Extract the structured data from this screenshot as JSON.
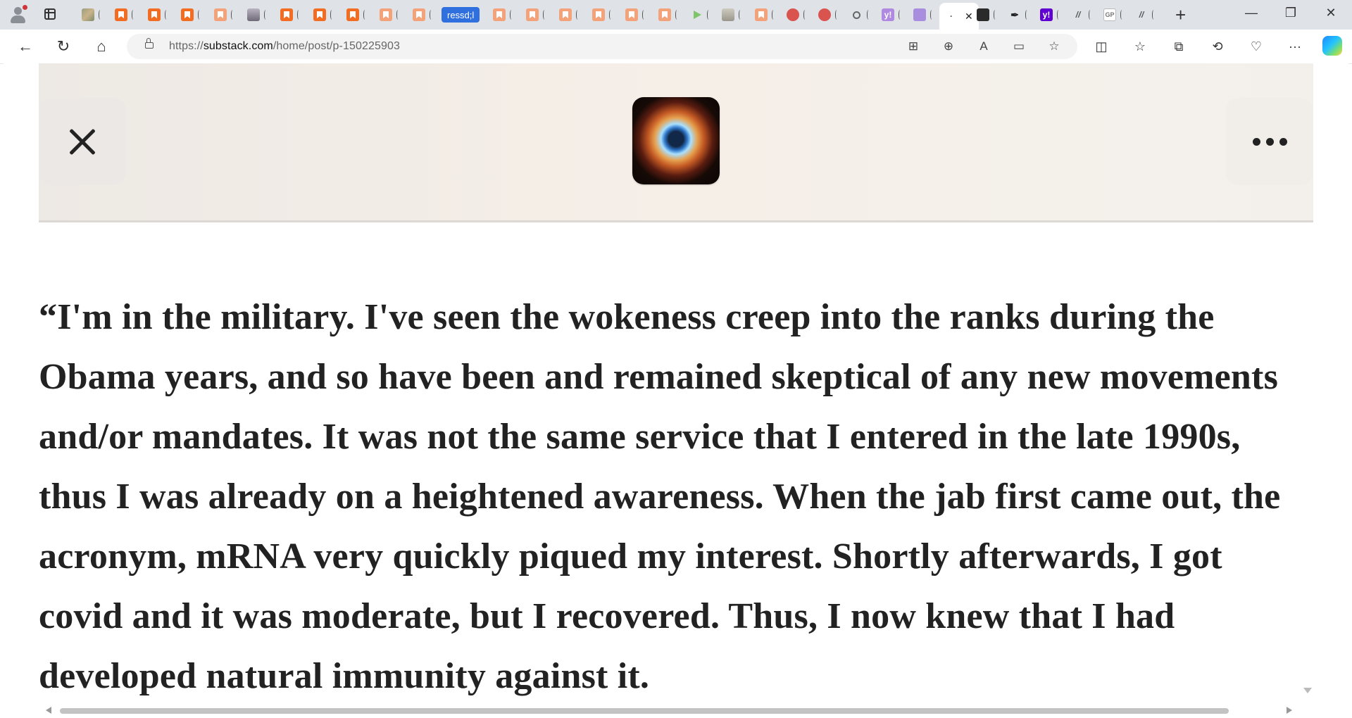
{
  "browser": {
    "highlighted_tab_label": "ressd;l",
    "active_tab_close": "✕",
    "new_tab": "+",
    "window": {
      "minimize": "—",
      "restore": "❐",
      "close": "✕"
    },
    "favicons": {
      "yahoo": "y!",
      "gp": "GP",
      "substack_alt": "//"
    }
  },
  "toolbar": {
    "back": "←",
    "refresh": "↻",
    "home": "⌂",
    "url_prefix": "https://",
    "url_domain": "substack.com",
    "url_path": "/home/post/p-150225903",
    "icons": {
      "apps": "⊞",
      "zoom": "⊕",
      "read_aloud": "A",
      "immersive_reader": "▭",
      "favorite_star": "☆",
      "split_screen": "◫",
      "favorites": "☆",
      "collections": "⧉",
      "history": "⟲",
      "health": "♡",
      "more": "···"
    }
  },
  "post": {
    "quote": "“I'm in the military. I've seen the wokeness creep into the ranks during the Obama years, and so have been and remained skeptical of any new movements and/or mandates. It was not the same service that I entered in the late 1990s, thus I was already on a heightened awareness. When the jab first came out, the acronym, mRNA very quickly piqued my interest. Shortly afterwards, I got covid and it was moderate, but I recovered. Thus, I now knew that I had developed natural immunity against it."
  }
}
